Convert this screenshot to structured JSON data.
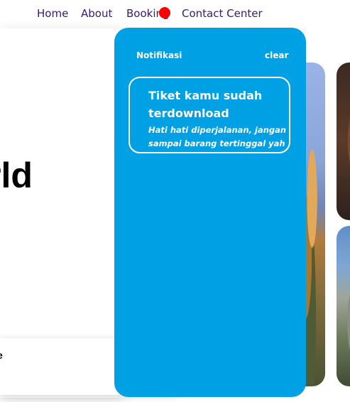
{
  "nav": {
    "items": [
      {
        "label": "Home"
      },
      {
        "label": "About"
      },
      {
        "label": "Booking"
      },
      {
        "label": "Contact Center"
      }
    ],
    "notification_dot_color": "#ff0000"
  },
  "hero": {
    "heading_fragment": "rld",
    "card_text_fragment": "e"
  },
  "notifications": {
    "title": "Notifikasi",
    "clear_label": "clear",
    "panel_color": "#00a1e4",
    "items": [
      {
        "title": "Tiket kamu sudah terdownload",
        "body": "Hati hati diperjalanan, jangan sampai barang tertinggal yah"
      }
    ]
  },
  "gallery": {
    "images": [
      {
        "icon": "traveler-photo"
      },
      {
        "icon": "portrait-photo"
      },
      {
        "icon": "landscape-photo"
      }
    ]
  }
}
